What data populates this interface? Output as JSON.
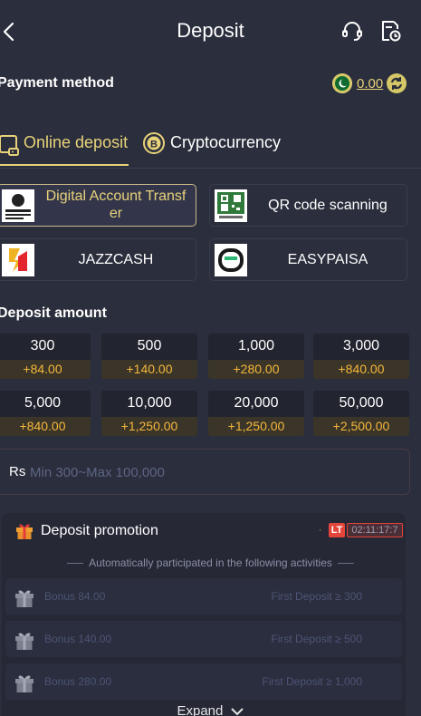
{
  "header": {
    "title": "Deposit",
    "back_icon": "chevron-left-icon",
    "support_icon": "headset-icon",
    "history_icon": "document-clock-icon"
  },
  "payment": {
    "label": "Payment method",
    "balance": "0.00",
    "flag_icon": "pakistan-flag-icon",
    "refresh_icon": "refresh-icon"
  },
  "tabs": [
    {
      "label": "Online deposit",
      "icon": "wallet-icon",
      "active": true
    },
    {
      "label": "Cryptocurrency",
      "icon": "bitcoin-icon",
      "active": false
    }
  ],
  "methods": [
    {
      "label": "Digital Account Transf\ner",
      "selected": true
    },
    {
      "label": "QR code scanning",
      "selected": false
    },
    {
      "label": "JAZZCASH",
      "selected": false
    },
    {
      "label": "EASYPAISA",
      "selected": false
    }
  ],
  "deposit_amount": {
    "label": "Deposit amount",
    "options": [
      {
        "value": "300",
        "bonus": "+84.00"
      },
      {
        "value": "500",
        "bonus": "+140.00"
      },
      {
        "value": "1,000",
        "bonus": "+280.00"
      },
      {
        "value": "3,000",
        "bonus": "+840.00"
      },
      {
        "value": "5,000",
        "bonus": "+840.00"
      },
      {
        "value": "10,000",
        "bonus": "+1,250.00"
      },
      {
        "value": "20,000",
        "bonus": "+1,250.00"
      },
      {
        "value": "50,000",
        "bonus": "+2,500.00"
      }
    ]
  },
  "amount_input": {
    "currency": "Rs",
    "placeholder": "Min 300~Max 100,000",
    "value": ""
  },
  "promotion": {
    "title": "Deposit promotion",
    "badge": "LT",
    "timer": "02:11:17:7",
    "auto_text": "Automatically participated in the following activities",
    "bonuses": [
      {
        "label": "Bonus 84.00",
        "condition": "First Deposit ≥ 300"
      },
      {
        "label": "Bonus 140.00",
        "condition": "First Deposit ≥ 500"
      },
      {
        "label": "Bonus 280.00",
        "condition": "First Deposit ≥ 1,000"
      }
    ],
    "expand_label": "Expand"
  },
  "colors": {
    "background": "#2b2e3c",
    "accent_gold": "#e8d27a",
    "bonus_orange": "#f6b73c",
    "badge_red": "#e4453a"
  }
}
